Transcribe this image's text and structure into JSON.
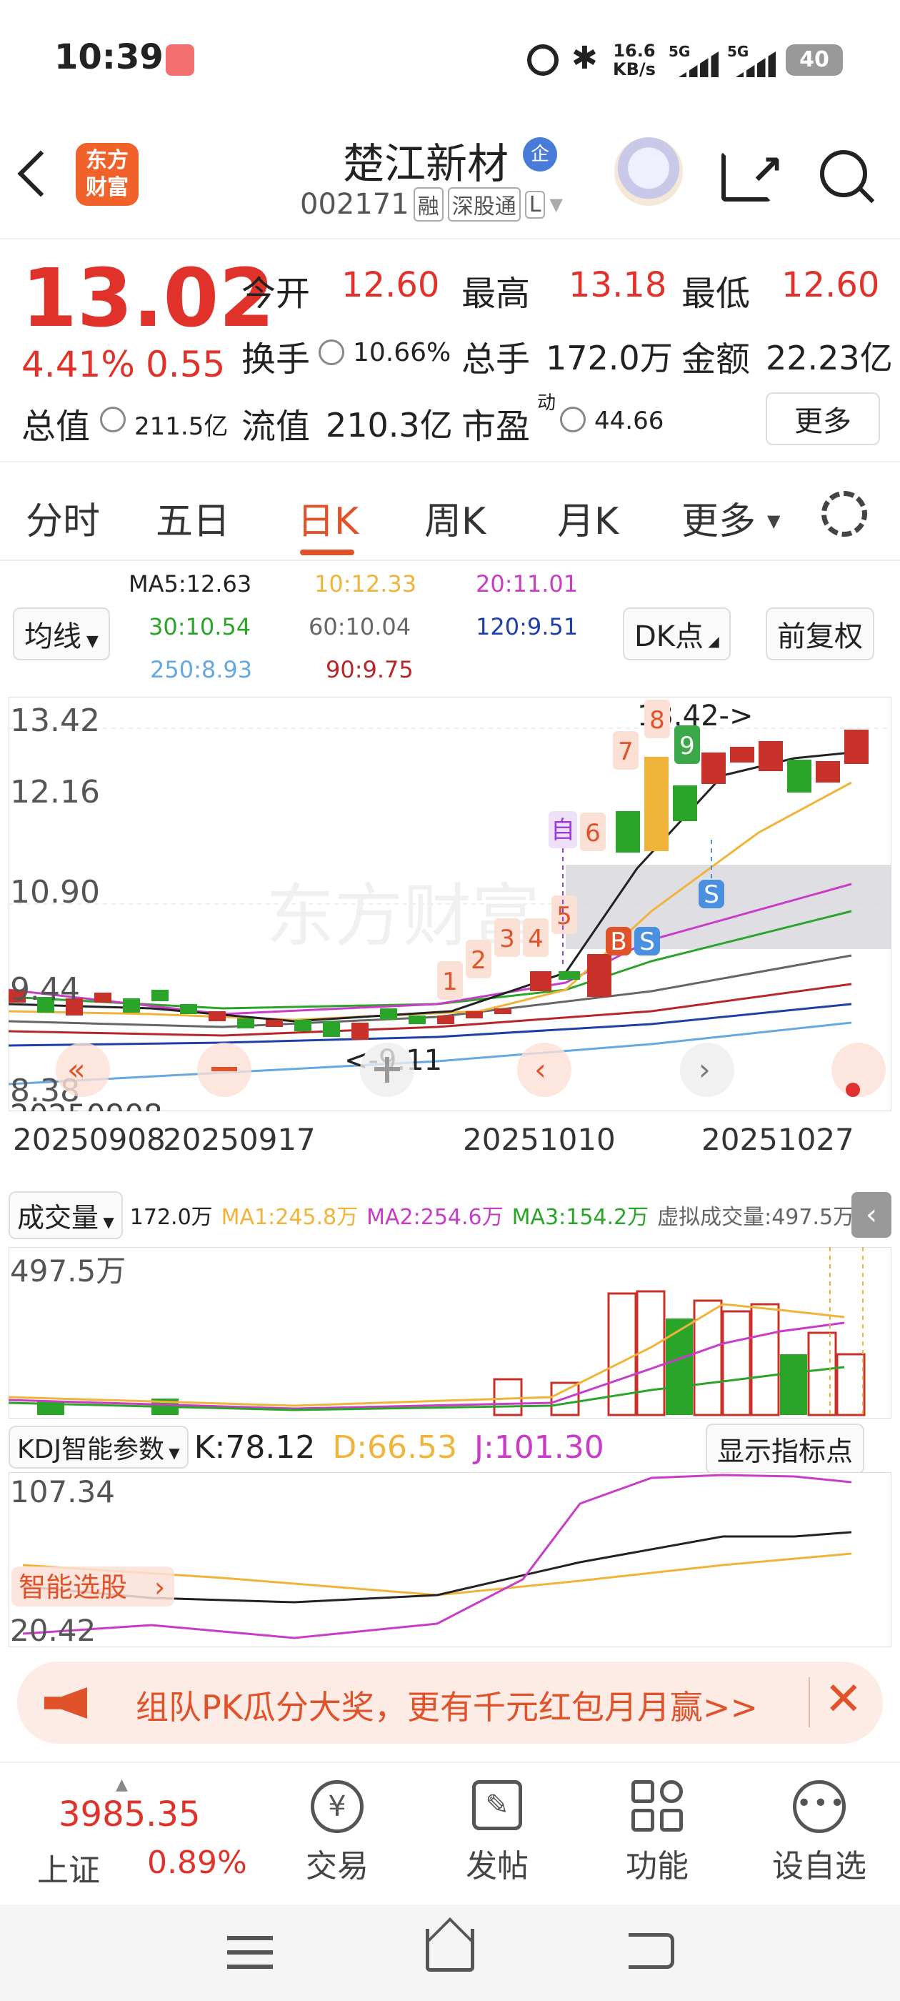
{
  "status_bar": {
    "time": "10:39",
    "net_speed_top": "16.6",
    "net_speed_bottom": "KB/s",
    "sig1": "5G",
    "sig2": "5G",
    "battery": "40"
  },
  "header": {
    "logo_line1": "东方",
    "logo_line2": "财富",
    "title": "楚江新材",
    "badge": "企",
    "code": "002171",
    "tag1": "融",
    "tag2": "深股通",
    "tag3": "L"
  },
  "quote": {
    "price": "13.02",
    "change_pct": "4.41%",
    "change": "0.55",
    "open_label": "今开",
    "open": "12.60",
    "high_label": "最高",
    "high": "13.18",
    "low_label": "最低",
    "low": "12.60",
    "turnover_label": "换手",
    "turnover": "10.66%",
    "volume_label": "总手",
    "volume": "172.0万",
    "amount_label": "金额",
    "amount": "22.23亿",
    "mktcap_label": "总值",
    "mktcap": "211.5亿",
    "float_label": "流值",
    "float": "210.3亿",
    "pe_label": "市盈",
    "pe_sup": "动",
    "pe": "44.66",
    "more": "更多"
  },
  "tabs": [
    "分时",
    "五日",
    "日K",
    "周K",
    "月K",
    "更多"
  ],
  "ma": {
    "selector": "均线",
    "ma5": "MA5:12.63",
    "ma10": "10:12.33",
    "ma20": "20:11.01",
    "ma30": "30:10.54",
    "ma60": "60:10.04",
    "ma120": "120:9.51",
    "ma250": "250:8.93",
    "ma90": "90:9.75",
    "dk": "DK点",
    "fq": "前复权",
    "c_ma5": "#222222",
    "c_ma10": "#f0b43a",
    "c_ma20": "#c83cc8",
    "c_ma30": "#2aa52a",
    "c_ma60": "#666666",
    "c_ma120": "#1f3fa8",
    "c_ma250": "#66a8e0",
    "c_ma90": "#b8262a"
  },
  "kline": {
    "y_labels": [
      "13.42",
      "12.16",
      "10.90",
      "9.44",
      "8.38"
    ],
    "x_labels": [
      "20250908",
      "20250917",
      "20251010",
      "20251027"
    ],
    "high_marker": "13.42->",
    "low_marker": "<-9.11",
    "watermark": "东方财富",
    "signals": [
      "1",
      "2",
      "3",
      "4",
      "5",
      "6",
      "7",
      "8",
      "9"
    ],
    "self_tag": "自",
    "b_tag": "B",
    "s_tag": "S"
  },
  "volume": {
    "selector": "成交量",
    "vol": "172.0万",
    "ma1": "MA1:245.8万",
    "ma2": "MA2:254.6万",
    "ma3": "MA3:154.2万",
    "virtual": "虚拟成交量:497.5万",
    "y_label": "497.5万"
  },
  "kdj": {
    "selector": "KDJ智能参数",
    "k": "K:78.12",
    "d": "D:66.53",
    "j": "J:101.30",
    "toggle": "显示指标点",
    "y_top": "107.34",
    "y_bottom": "20.42",
    "smart": "智能选股"
  },
  "banner": {
    "text": "组队PK瓜分大奖，更有千元红包月月赢>>"
  },
  "bottom": {
    "index_value": "3985.35",
    "index_name": "上证",
    "index_change": "0.89%",
    "items": [
      "交易",
      "发帖",
      "功能",
      "设自选"
    ]
  }
}
